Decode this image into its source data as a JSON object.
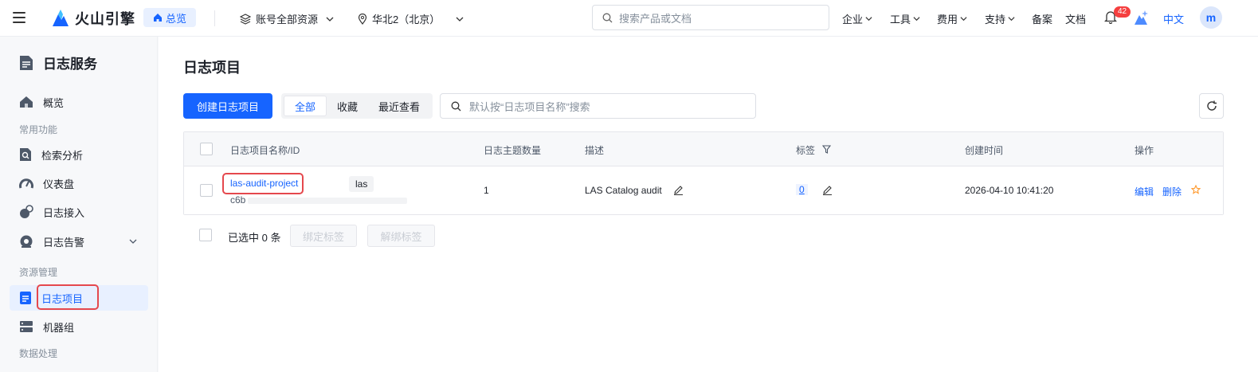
{
  "topbar": {
    "brand": "火山引擎",
    "home": "总览",
    "account_scope": "账号全部资源",
    "region": "华北2（北京）",
    "search_placeholder": "搜索产品或文档",
    "menus": [
      "企业",
      "工具",
      "费用",
      "支持"
    ],
    "links": [
      "备案",
      "文档"
    ],
    "notification_count": "42",
    "language": "中文",
    "avatar_letter": "m"
  },
  "sidebar": {
    "title": "日志服务",
    "overview": "概览",
    "group_common": "常用功能",
    "search_analysis": "检索分析",
    "dashboard": "仪表盘",
    "log_ingest": "日志接入",
    "log_alert": "日志告警",
    "group_resource": "资源管理",
    "log_project": "日志项目",
    "machine_group": "机器组",
    "group_data": "数据处理"
  },
  "main": {
    "title": "日志项目",
    "create_button": "创建日志项目",
    "filters": [
      "全部",
      "收藏",
      "最近查看"
    ],
    "search_placeholder": "默认按“日志项目名称”搜索",
    "columns": {
      "name": "日志项目名称/ID",
      "topic_count": "日志主题数量",
      "description": "描述",
      "tags": "标签",
      "created": "创建时间",
      "actions": "操作"
    },
    "rows": [
      {
        "name": "las-audit-project",
        "tag": "las",
        "id_prefix": "c6b",
        "topic_count": "1",
        "description": "LAS Catalog audit",
        "tag_count": "0",
        "created": "2026-04-10 10:41:20",
        "edit": "编辑",
        "delete": "删除"
      }
    ],
    "selected_text": "已选中 0 条",
    "bind_tag": "绑定标签",
    "unbind_tag": "解绑标签"
  },
  "colors": {
    "accent": "#1664ff",
    "highlight": "#e5484d"
  }
}
